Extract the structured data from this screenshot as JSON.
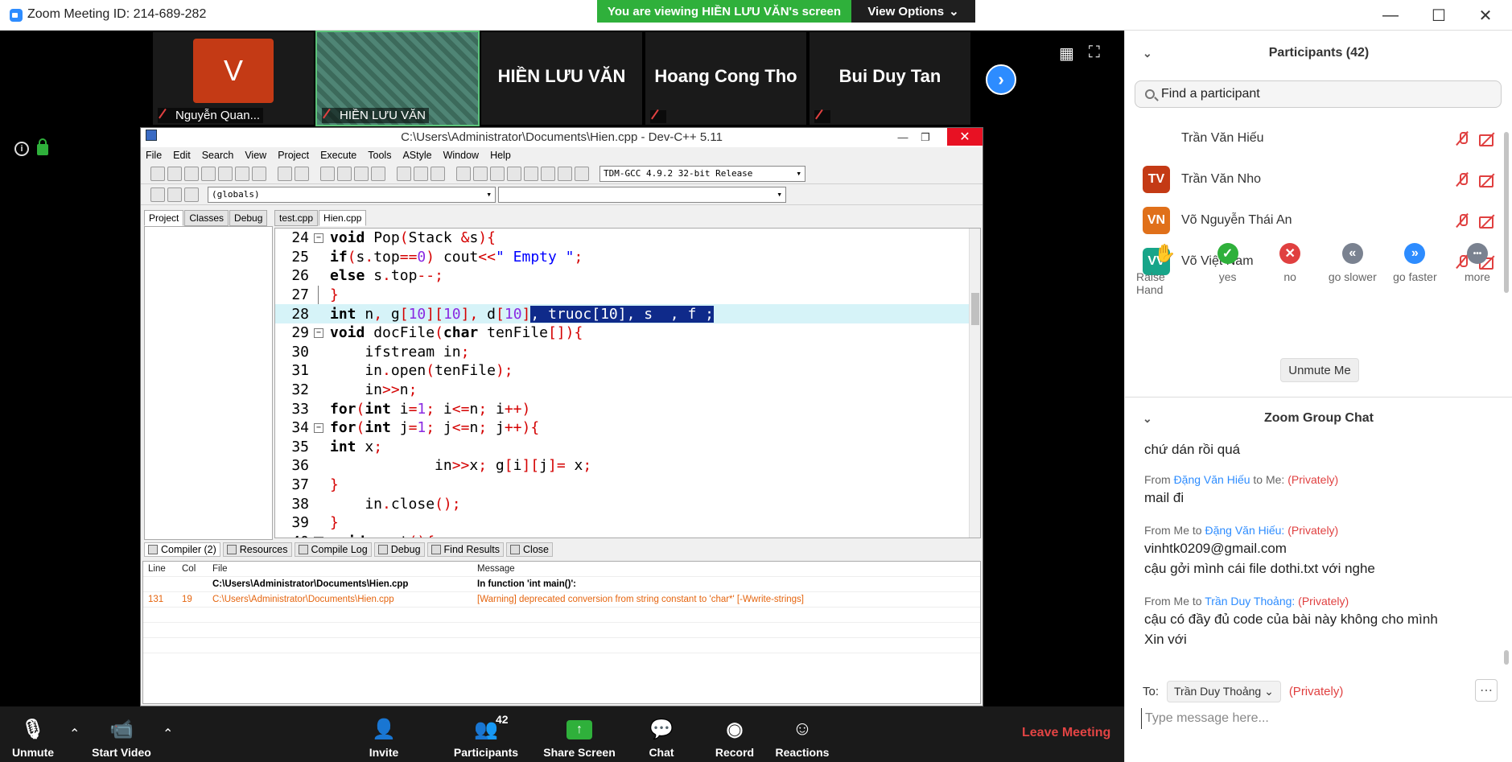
{
  "window": {
    "title": "Zoom Meeting ID: 214-689-282"
  },
  "banner": {
    "viewing": "You are viewing HIỀN LƯU VĂN's screen",
    "view_options": "View Options"
  },
  "thumbs": [
    {
      "avatar": "V",
      "label": "Nguyễn Quan..."
    },
    {
      "avatar": "",
      "label": "HIỀN LƯU VĂN"
    },
    {
      "big": "HIỀN LƯU VĂN"
    },
    {
      "big": "Hoang Cong Tho"
    },
    {
      "big": "Bui Duy Tan"
    }
  ],
  "devcpp": {
    "title": "C:\\Users\\Administrator\\Documents\\Hien.cpp - Dev-C++ 5.11",
    "menu": [
      "File",
      "Edit",
      "Search",
      "View",
      "Project",
      "Execute",
      "Tools",
      "AStyle",
      "Window",
      "Help"
    ],
    "compiler_select": "TDM-GCC 4.9.2 32-bit Release",
    "globals_select": "(globals)",
    "proj_tabs": [
      "Project",
      "Classes",
      "Debug"
    ],
    "file_tabs": [
      "test.cpp",
      "Hien.cpp"
    ],
    "bottom_tabs": [
      "Compiler (2)",
      "Resources",
      "Compile Log",
      "Debug",
      "Find Results",
      "Close"
    ],
    "results_headers": [
      "Line",
      "Col",
      "File",
      "Message"
    ],
    "results": [
      {
        "line": "",
        "col": "",
        "file": "C:\\Users\\Administrator\\Documents\\Hien.cpp",
        "msg": "In function 'int main()':"
      },
      {
        "line": "131",
        "col": "19",
        "file": "C:\\Users\\Administrator\\Documents\\Hien.cpp",
        "msg": "[Warning] deprecated conversion from string constant to 'char*' [-Wwrite-strings]"
      }
    ]
  },
  "bottom_bar": {
    "unmute": "Unmute",
    "start_video": "Start Video",
    "invite": "Invite",
    "participants": "Participants",
    "participants_count": "42",
    "share_screen": "Share Screen",
    "chat": "Chat",
    "record": "Record",
    "reactions": "Reactions",
    "leave": "Leave Meeting"
  },
  "participants": {
    "title": "Participants (42)",
    "search_placeholder": "Find a participant",
    "rows": [
      {
        "initials": "",
        "name": "Trần Văn Hiếu",
        "color": "#ffffff"
      },
      {
        "initials": "TV",
        "name": "Trần Văn Nho",
        "color": "#c43a15"
      },
      {
        "initials": "VN",
        "name": "Võ Nguyễn Thái An",
        "color": "#e0701a"
      },
      {
        "initials": "VV",
        "name": "Võ Việt Nam",
        "color": "#17a589"
      }
    ],
    "reactions": [
      {
        "label": "Raise Hand",
        "icon": "✋",
        "color": "#2d8cff"
      },
      {
        "label": "yes",
        "icon": "✓",
        "color": "#2fb03b"
      },
      {
        "label": "no",
        "icon": "✕",
        "color": "#e04040"
      },
      {
        "label": "go slower",
        "icon": "«",
        "color": "#7a8290"
      },
      {
        "label": "go faster",
        "icon": "»",
        "color": "#2d8cff"
      },
      {
        "label": "more",
        "icon": "•••",
        "color": "#7a8290"
      }
    ],
    "unmute_me": "Unmute Me"
  },
  "chat": {
    "title": "Zoom Group Chat",
    "messages": {
      "m0": "chứ dán rồi quá",
      "m1_from": "From",
      "m1_name": "Đặng Văn Hiếu",
      "m1_to": "to Me:",
      "m1_priv": "(Privately)",
      "m1_text": "mail đi",
      "m2_from": "From Me to",
      "m2_name": "Đặng Văn Hiếu:",
      "m2_priv": "(Privately)",
      "m2_text1": "vinhtk0209@gmail.com",
      "m2_text2": "cậu gởi mình cái file dothi.txt với nghe",
      "m3_from": "From Me to",
      "m3_name": "Trần Duy Thoảng:",
      "m3_priv": "(Privately)",
      "m3_text1": "cậu có đầy đủ code của bài này không cho mình",
      "m3_text2": "Xin với"
    },
    "to_label": "To:",
    "to_value": "Trần Duy Thoảng",
    "to_priv": "(Privately)",
    "input_placeholder": "Type message here..."
  }
}
